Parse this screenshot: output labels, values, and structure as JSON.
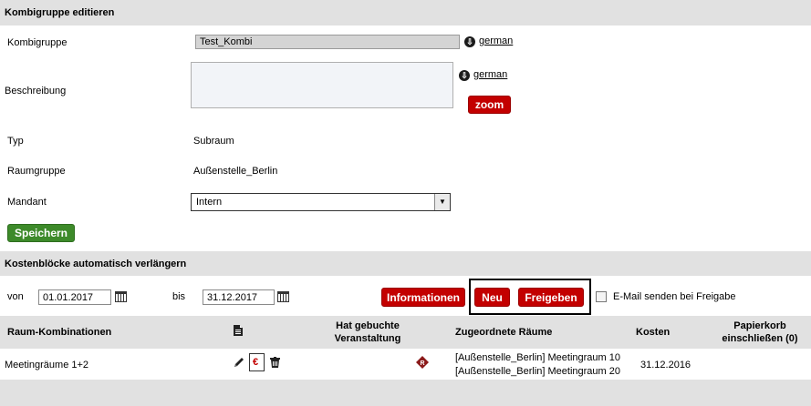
{
  "edit": {
    "title": "Kombigruppe editieren",
    "kombigruppe_label": "Kombigruppe",
    "kombigruppe_value": "Test_Kombi",
    "lang1": "german",
    "beschreibung_label": "Beschreibung",
    "beschreibung_value": "",
    "lang2": "german",
    "zoom": "zoom",
    "typ_label": "Typ",
    "typ_value": "Subraum",
    "raumgruppe_label": "Raumgruppe",
    "raumgruppe_value": "Außenstelle_Berlin",
    "mandant_label": "Mandant",
    "mandant_value": "Intern",
    "save": "Speichern"
  },
  "cost": {
    "title": "Kostenblöcke automatisch verlängern",
    "von_label": "von",
    "von_value": "01.01.2017",
    "bis_label": "bis",
    "bis_value": "31.12.2017",
    "btn_info": "Informationen",
    "btn_new": "Neu",
    "btn_release": "Freigeben",
    "email_label": "E-Mail senden bei Freigabe",
    "email_checked": false
  },
  "table": {
    "headers": {
      "raum": "Raum-Kombinationen",
      "hat1": "Hat gebuchte",
      "hat2": "Veranstaltung",
      "zug": "Zugeordnete Räume",
      "kosten": "Kosten",
      "papier1": "Papierkorb",
      "papier2": "einschließen  (0)"
    },
    "rows": [
      {
        "name": "Meetingräume 1+2",
        "room1": "[Außenstelle_Berlin]  Meetingraum 10",
        "room2": "[Außenstelle_Berlin]  Meetingraum 20",
        "kosten": "31.12.2016"
      }
    ]
  },
  "colors": {
    "accent_red": "#c30000",
    "accent_green": "#3d8a2a",
    "section_bg": "#e1e1e1"
  },
  "icons": [
    "download-arrow-icon",
    "calendar-icon",
    "document-icon",
    "pencil-icon",
    "euro-document-icon",
    "trash-icon",
    "registered-diamond-icon"
  ]
}
